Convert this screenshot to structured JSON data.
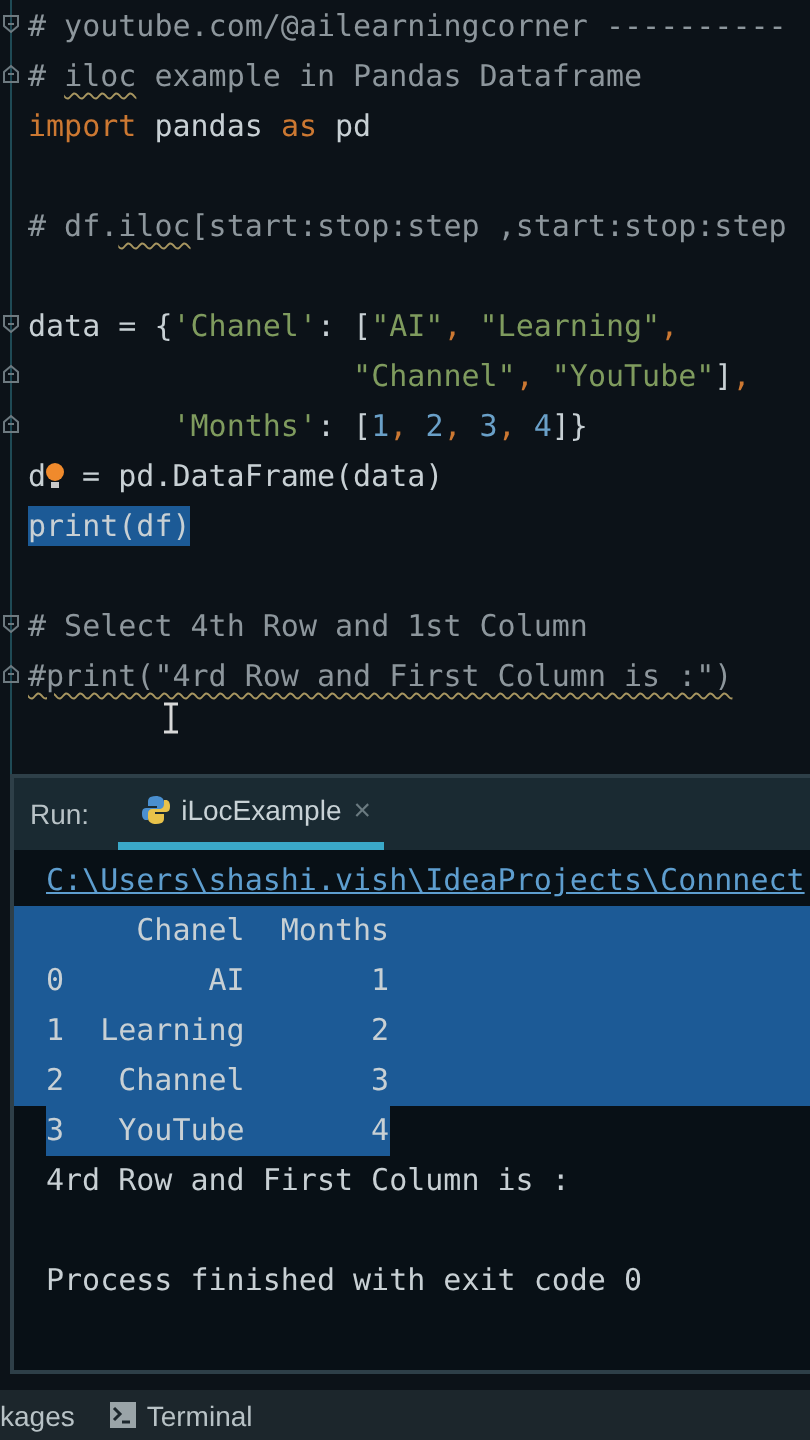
{
  "editor": {
    "blocks": [
      {
        "lines": [
          {
            "fold_start": true,
            "fold_end": false,
            "selected": false,
            "tokens": [
              {
                "kind": "comment",
                "text": "# youtube.com/@ailearningcorner ----------"
              }
            ]
          },
          {
            "fold_start": false,
            "fold_end": true,
            "selected": false,
            "tokens": [
              {
                "kind": "comment",
                "text": "# "
              },
              {
                "kind": "comment",
                "text": "iloc",
                "squiggle": true
              },
              {
                "kind": "comment",
                "text": " example in Pandas Dataframe"
              }
            ]
          },
          {
            "fold_start": false,
            "fold_end": false,
            "selected": false,
            "tokens": [
              {
                "kind": "keyword",
                "text": "import"
              },
              {
                "kind": "plain",
                "text": " pandas "
              },
              {
                "kind": "keyword",
                "text": "as"
              },
              {
                "kind": "plain",
                "text": " pd"
              }
            ]
          }
        ]
      },
      {
        "lines": [
          {
            "fold_start": false,
            "fold_end": false,
            "selected": false,
            "tokens": [
              {
                "kind": "comment",
                "text": "# df."
              },
              {
                "kind": "comment",
                "text": "iloc",
                "squiggle": true
              },
              {
                "kind": "comment",
                "text": "[start:stop:step ,start:stop:step"
              }
            ]
          }
        ]
      },
      {
        "lines": [
          {
            "fold_start": true,
            "fold_end": false,
            "selected": false,
            "tokens": [
              {
                "kind": "plain",
                "text": "data = {"
              },
              {
                "kind": "string",
                "text": "'Chanel'"
              },
              {
                "kind": "plain",
                "text": ": ["
              },
              {
                "kind": "string",
                "text": "\"AI\""
              },
              {
                "kind": "keyword",
                "text": ", "
              },
              {
                "kind": "string",
                "text": "\"Learning\""
              },
              {
                "kind": "keyword",
                "text": ","
              }
            ]
          },
          {
            "fold_start": false,
            "fold_end": true,
            "selected": false,
            "tokens": [
              {
                "kind": "string",
                "text": "                  \"Channel\""
              },
              {
                "kind": "keyword",
                "text": ", "
              },
              {
                "kind": "string",
                "text": "\"YouTube\""
              },
              {
                "kind": "plain",
                "text": "]"
              },
              {
                "kind": "keyword",
                "text": ","
              }
            ]
          },
          {
            "fold_start": false,
            "fold_end": true,
            "selected": false,
            "tokens": [
              {
                "kind": "string",
                "text": "        'Months'"
              },
              {
                "kind": "plain",
                "text": ": ["
              },
              {
                "kind": "number",
                "text": "1"
              },
              {
                "kind": "keyword",
                "text": ", "
              },
              {
                "kind": "number",
                "text": "2"
              },
              {
                "kind": "keyword",
                "text": ", "
              },
              {
                "kind": "number",
                "text": "3"
              },
              {
                "kind": "keyword",
                "text": ", "
              },
              {
                "kind": "number",
                "text": "4"
              },
              {
                "kind": "plain",
                "text": "]}"
              }
            ]
          },
          {
            "fold_start": false,
            "fold_end": false,
            "selected": false,
            "tokens": [
              {
                "kind": "plain",
                "text": "d"
              },
              {
                "kind": "bulb"
              },
              {
                "kind": "plain",
                "text": " = pd.DataFrame(data)"
              }
            ]
          },
          {
            "fold_start": false,
            "fold_end": false,
            "selected": true,
            "tokens": [
              {
                "kind": "plain",
                "text": "print(df)"
              }
            ]
          }
        ]
      },
      {
        "lines": [
          {
            "fold_start": true,
            "fold_end": false,
            "selected": false,
            "tokens": [
              {
                "kind": "comment",
                "text": "# Select 4th Row and 1st Column"
              }
            ]
          },
          {
            "fold_start": false,
            "fold_end": true,
            "selected": false,
            "tokens": [
              {
                "kind": "comment",
                "text": "#print(\"4rd Row and First Column is :\")",
                "squiggle": true
              }
            ]
          }
        ]
      }
    ]
  },
  "run_panel": {
    "label": "Run:",
    "tabs": [
      {
        "label": "iLocExample",
        "close": "×",
        "selected": true
      }
    ],
    "path": "C:\\Users\\shashi.vish\\IdeaProjects\\Connnect",
    "blocks": [
      {
        "lines": [
          {
            "text": "     Chanel  Months",
            "selected": true
          },
          {
            "text": "0        AI       1",
            "selected": true
          },
          {
            "text": "1  Learning       2",
            "selected": true
          },
          {
            "text": "2   Channel       3",
            "selected": true
          },
          {
            "text": "3   YouTube       4",
            "selected": true
          },
          {
            "text": "4rd Row and First Column is :",
            "selected": false
          }
        ]
      },
      {
        "lines": [
          {
            "text": "Process finished with exit code 0",
            "selected": false
          }
        ]
      }
    ]
  },
  "bottom_bar": {
    "items": [
      {
        "kind": "plain",
        "label": "kages"
      },
      {
        "kind": "terminal",
        "label": "Terminal"
      }
    ]
  }
}
